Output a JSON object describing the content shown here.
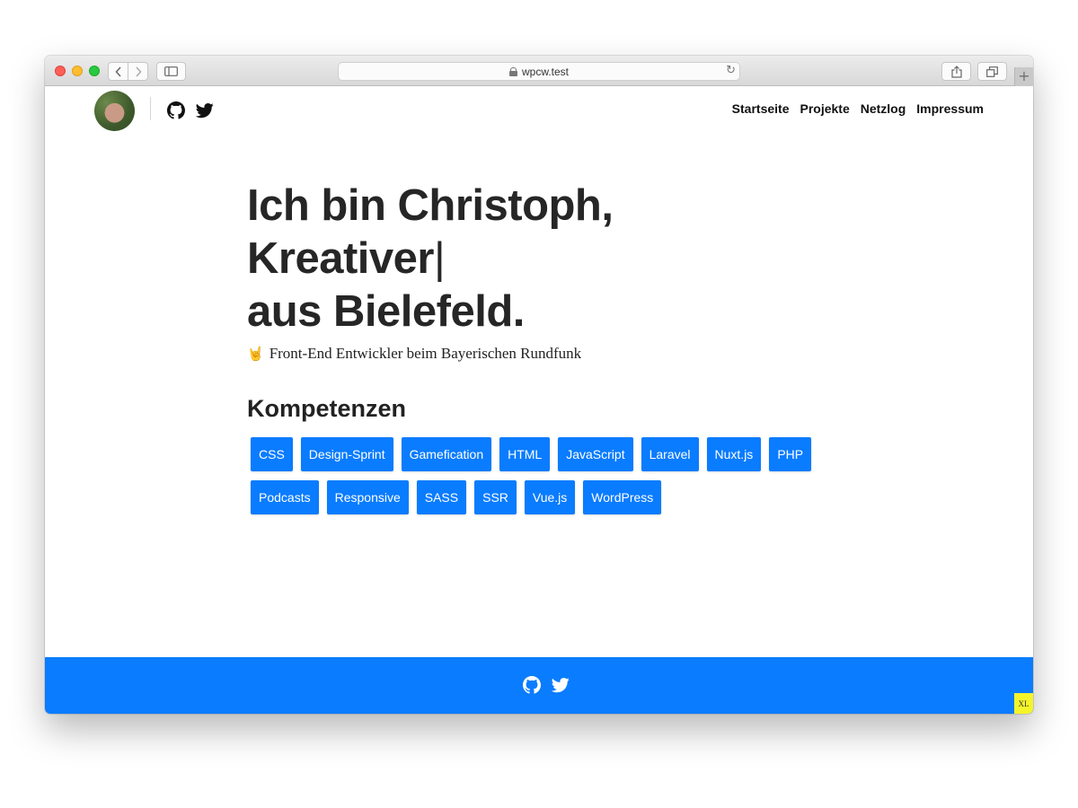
{
  "browser": {
    "url": "wpcw.test",
    "back_icon": "chevron-left-icon",
    "forward_icon": "chevron-right-icon",
    "new_tab_label": "+"
  },
  "header": {
    "nav": [
      {
        "label": "Startseite"
      },
      {
        "label": "Projekte"
      },
      {
        "label": "Netzlog"
      },
      {
        "label": "Impressum"
      }
    ]
  },
  "hero": {
    "line1": "Ich bin Christoph,",
    "line2": "Kreativer",
    "cursor": "|",
    "line3": "aus Bielefeld.",
    "subtitle_icon": "rock-hand-icon",
    "subtitle": "Front-End Entwickler beim Bayerischen Rundfunk"
  },
  "skills": {
    "title": "Kompetenzen",
    "tags": [
      "CSS",
      "Design-Sprint",
      "Gamefication",
      "HTML",
      "JavaScript",
      "Laravel",
      "Nuxt.js",
      "PHP",
      "Podcasts",
      "Responsive",
      "SASS",
      "SSR",
      "Vue.js",
      "WordPress"
    ]
  },
  "footer": {
    "badge": "XL"
  },
  "colors": {
    "accent": "#0a7cff",
    "text": "#262626",
    "badge": "#f4f42a"
  }
}
